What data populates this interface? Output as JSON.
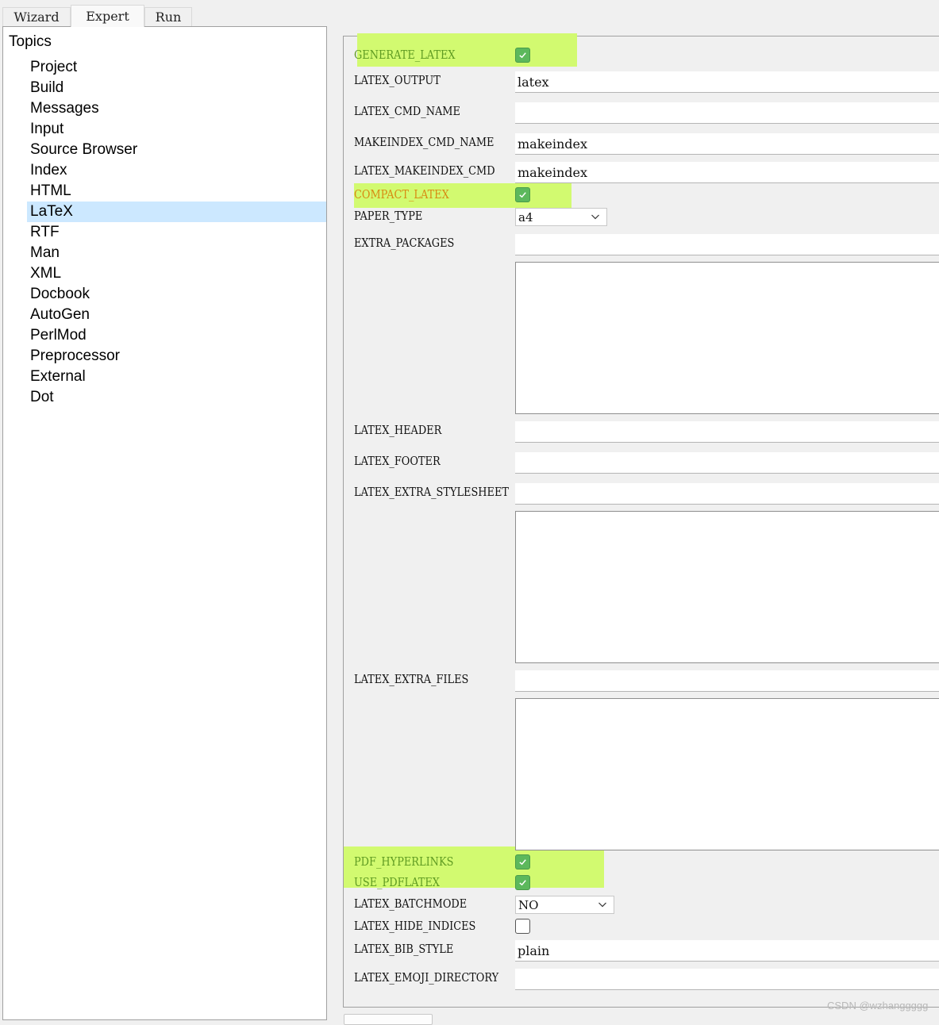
{
  "tabs": [
    "Wizard",
    "Expert",
    "Run"
  ],
  "topics": {
    "title": "Topics",
    "items": [
      "Project",
      "Build",
      "Messages",
      "Input",
      "Source Browser",
      "Index",
      "HTML",
      "LaTeX",
      "RTF",
      "Man",
      "XML",
      "Docbook",
      "AutoGen",
      "PerlMod",
      "Preprocessor",
      "External",
      "Dot"
    ],
    "selected": "LaTeX"
  },
  "settings": {
    "generate_latex": {
      "label": "GENERATE_LATEX",
      "checked": true
    },
    "latex_output": {
      "label": "LATEX_OUTPUT",
      "value": "latex"
    },
    "latex_cmd_name": {
      "label": "LATEX_CMD_NAME",
      "value": ""
    },
    "makeindex_cmd_name": {
      "label": "MAKEINDEX_CMD_NAME",
      "value": "makeindex"
    },
    "latex_makeindex_cmd": {
      "label": "LATEX_MAKEINDEX_CMD",
      "value": "makeindex"
    },
    "compact_latex": {
      "label": "COMPACT_LATEX",
      "checked": true
    },
    "paper_type": {
      "label": "PAPER_TYPE",
      "value": "a4"
    },
    "extra_packages": {
      "label": "EXTRA_PACKAGES",
      "value": ""
    },
    "latex_header": {
      "label": "LATEX_HEADER",
      "value": ""
    },
    "latex_footer": {
      "label": "LATEX_FOOTER",
      "value": ""
    },
    "latex_extra_stylesheet": {
      "label": "LATEX_EXTRA_STYLESHEET",
      "value": ""
    },
    "latex_extra_files": {
      "label": "LATEX_EXTRA_FILES",
      "value": ""
    },
    "pdf_hyperlinks": {
      "label": "PDF_HYPERLINKS",
      "checked": true
    },
    "use_pdflatex": {
      "label": "USE_PDFLATEX",
      "checked": true
    },
    "latex_batchmode": {
      "label": "LATEX_BATCHMODE",
      "value": "NO"
    },
    "latex_hide_indices": {
      "label": "LATEX_HIDE_INDICES",
      "checked": false
    },
    "latex_bib_style": {
      "label": "LATEX_BIB_STYLE",
      "value": "plain"
    },
    "latex_emoji_directory": {
      "label": "LATEX_EMOJI_DIRECTORY",
      "value": ""
    }
  },
  "colors": {
    "highlight": "#d2fa70",
    "checkbox_checked": "#5cb85c",
    "selected_topic": "#cce8ff",
    "label_changed": "#5f9b22",
    "label_overridden": "#d88a12"
  },
  "watermark": "CSDN @wzhanggggg"
}
